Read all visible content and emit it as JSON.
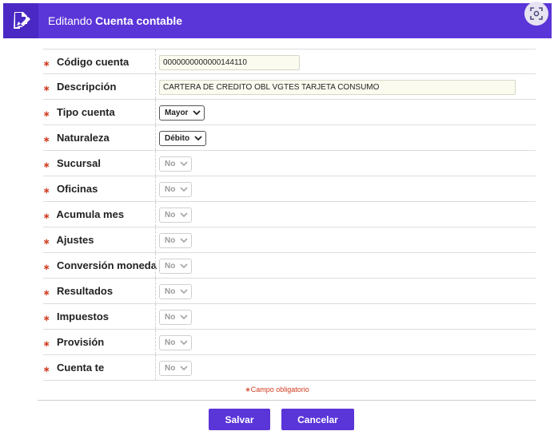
{
  "header": {
    "prefix": "Editando",
    "title": "Cuenta contable",
    "accent_color": "#5a35d8"
  },
  "fields": [
    {
      "label": "Código cuenta",
      "type": "input",
      "value": "0000000000000144110"
    },
    {
      "label": "Descripción",
      "type": "input",
      "value": "CARTERA DE CREDITO OBL VGTES TARJETA CONSUMO"
    },
    {
      "label": "Tipo cuenta",
      "type": "select",
      "value": "Mayor"
    },
    {
      "label": "Naturaleza",
      "type": "select",
      "value": "Débito"
    },
    {
      "label": "Sucursal",
      "type": "select-disabled",
      "value": "No"
    },
    {
      "label": "Oficinas",
      "type": "select-disabled",
      "value": "No"
    },
    {
      "label": "Acumula mes",
      "type": "select-disabled",
      "value": "No"
    },
    {
      "label": "Ajustes",
      "type": "select-disabled",
      "value": "No"
    },
    {
      "label": "Conversión moneda",
      "type": "select-disabled",
      "value": "No"
    },
    {
      "label": "Resultados",
      "type": "select-disabled",
      "value": "No"
    },
    {
      "label": "Impuestos",
      "type": "select-disabled",
      "value": "No"
    },
    {
      "label": "Provisión",
      "type": "select-disabled",
      "value": "No"
    },
    {
      "label": "Cuenta te",
      "type": "select-disabled",
      "value": "No"
    }
  ],
  "required_star": "∗",
  "required_note": "Campo obligatorio",
  "buttons": {
    "save": "Salvar",
    "cancel": "Cancelar"
  },
  "icons": {
    "header": "edit-document-icon",
    "screenshot": "screenshot-capture-icon"
  }
}
